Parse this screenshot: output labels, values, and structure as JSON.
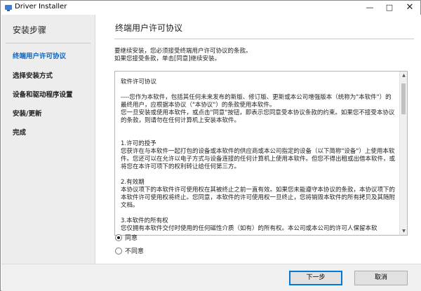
{
  "window": {
    "title": "Driver Installer",
    "controls": {
      "minimize": "—",
      "maximize": "□",
      "close": "✕"
    }
  },
  "sidebar": {
    "title": "安装步骤",
    "steps": [
      {
        "label": "终端用户许可协议",
        "current": true
      },
      {
        "label": "选择安装方式",
        "current": false
      },
      {
        "label": "设备和驱动程序设置",
        "current": false
      },
      {
        "label": "安装/更新",
        "current": false
      },
      {
        "label": "完成",
        "current": false
      }
    ]
  },
  "main": {
    "heading": "终端用户许可协议",
    "intro": "要继续安装，您必须接受终端用户许可协议的条款。\n如果您接受条款，单击[同意]继续安装。",
    "license_text": "软件许可协议\n\n----您作为本软件，包括其任何未来发布的新版、修订版、更新或本公司增强版本（统称为\"本软件\"）的最终用户，应根据本协议（\"本协议\"）的条款使用本软件。\n您一旦安装或使用本软件，或点击\"同意\"按钮，即表示您同意受本协议条款的约束。如果您不接受本协议的条款，则请勿在任何计算机上安装本软件。\n\n\n1.许可的授予\n您获许在与本软件一起打包的设备或本软件的供应商或本公司指定的设备（以下简称\"设备\"）上使用本软件。您还可以在允许以电子方式与设备连接的任何计算机上使用本软件。但您不得出租或出借本软件，或将您在本许可项下的权利转让给任何第三方。\n\n2.有效期\n本协议项下的本软件许可使用权在其被终止之前一直有效。如果您未能遵守本协议的条款，本协议项下的本软件许可使用权将终止。您同意，本软件的许可使用权一旦终止，您将销毁本软件的所有拷贝及其随附文档。\n\n3.本软件的所有权\n您仅拥有本软件交付时使用的任何磁性介质（如有）的所有权。本公司或本公司的许可人保留本软",
    "accept_label": "同意",
    "decline_label": "不同意",
    "accepted": true
  },
  "footer": {
    "next_label": "下一步",
    "cancel_label": "取消"
  },
  "colors": {
    "current_step": "#1565b7",
    "sidebar_bg": "#ededed",
    "footer_bg": "#f0f0f0"
  }
}
